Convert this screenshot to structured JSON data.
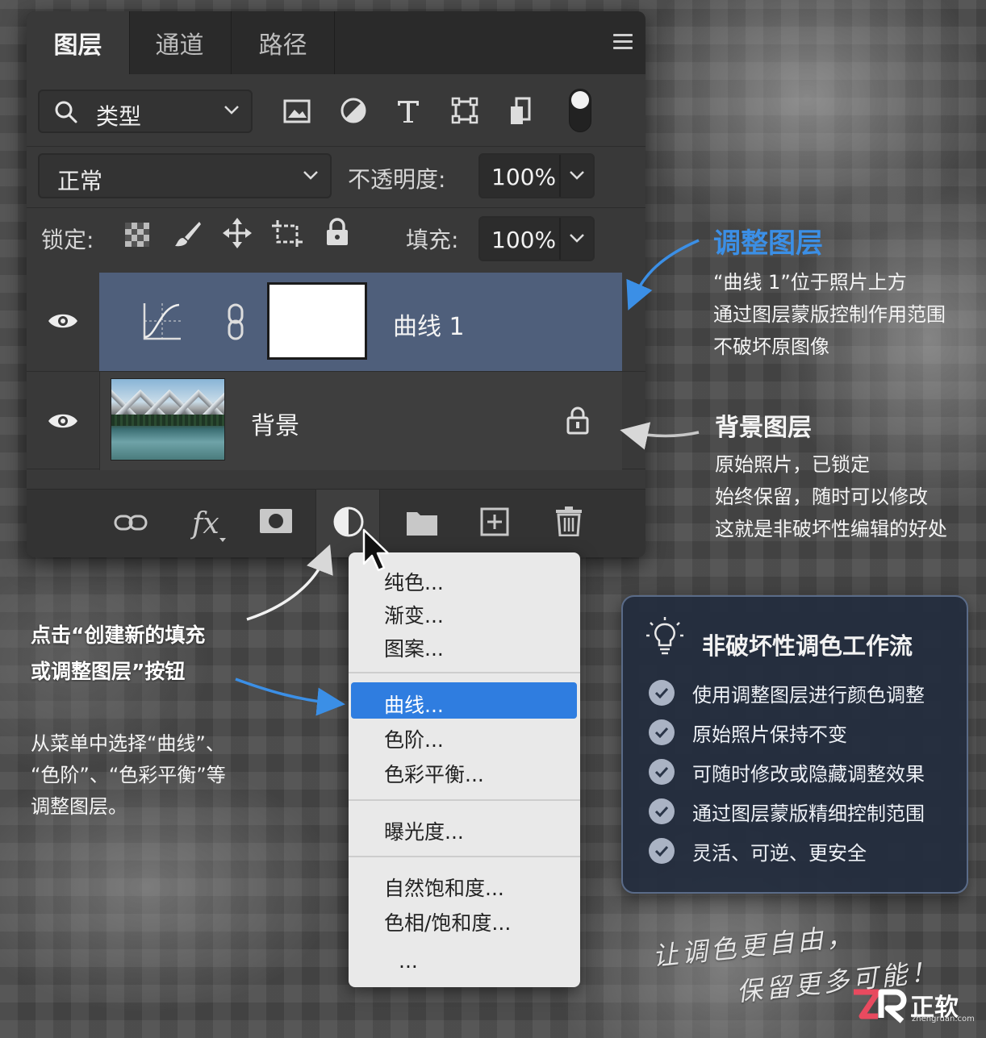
{
  "panel": {
    "tabs": [
      "图层",
      "通道",
      "路径"
    ],
    "filter_label": "类型",
    "blend_mode": "正常",
    "opacity_label": "不透明度:",
    "opacity_value": "100%",
    "lock_label": "锁定:",
    "fill_label": "填充:",
    "fill_value": "100%",
    "filter_toggle_on": true
  },
  "layers": [
    {
      "name": "曲线 1",
      "type": "adjustment-curves",
      "selected": true,
      "visible": true
    },
    {
      "name": "背景",
      "type": "background-photo",
      "selected": false,
      "visible": true,
      "locked": true
    }
  ],
  "menu": {
    "group1": [
      "纯色...",
      "渐变...",
      "图案..."
    ],
    "group2": [
      "曲线...",
      "色阶...",
      "色彩平衡..."
    ],
    "group3": [
      "曝光度..."
    ],
    "group4": [
      "自然饱和度...",
      "色相/饱和度...",
      "..."
    ],
    "highlighted": "曲线..."
  },
  "annotations": {
    "adj_title": "调整图层",
    "adj_lines": [
      "“曲线 1”位于照片上方",
      "通过图层蒙版控制作用范围",
      "不破坏原图像"
    ],
    "bg_title": "背景图层",
    "bg_lines": [
      "原始照片，已锁定",
      "始终保留，随时可以修改",
      "这就是非破坏性编辑的好处"
    ],
    "button_lines": [
      "点击“创建新的填充",
      "或调整图层”按钮"
    ],
    "menu_lines": [
      "从菜单中选择“曲线”、",
      "“色阶”、“色彩平衡”等",
      "调整图层。"
    ]
  },
  "card": {
    "title": "非破坏性调色工作流",
    "items": [
      "使用调整图层进行颜色调整",
      "原始照片保持不变",
      "可随时修改或隐藏调整效果",
      "通过图层蒙版精细控制范围",
      "灵活、可逆、更安全"
    ]
  },
  "slogan": [
    "让调色更自由，",
    "保留更多可能！"
  ],
  "logo": {
    "text": "正软",
    "url": "zhengruan.com"
  },
  "colors": {
    "accent": "#3b8fe6",
    "selected_layer": "#4f5f7b",
    "menu_highlight": "#2f7de0",
    "panel": "#393939"
  }
}
